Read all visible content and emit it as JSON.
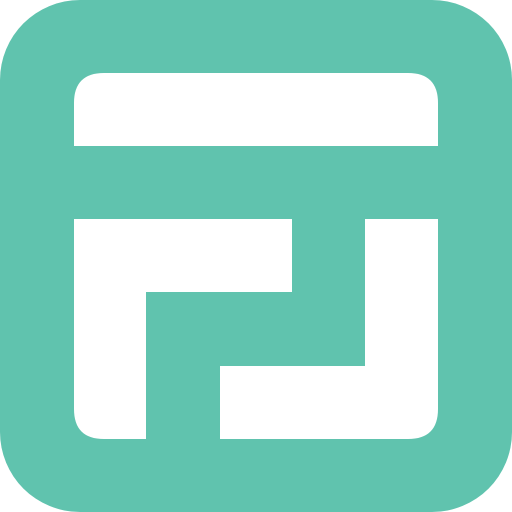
{
  "app_icon": {
    "icon": "app-logo-icon",
    "background_color": "#60C3AE",
    "glyph_color": "#FFFFFF"
  }
}
